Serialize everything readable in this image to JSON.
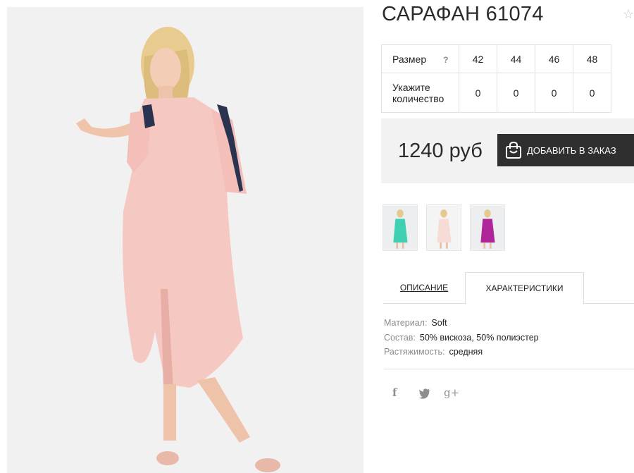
{
  "product": {
    "title": "САРАФАН 61074"
  },
  "sizes": {
    "row_label": "Размер",
    "help": "?",
    "values": [
      "42",
      "44",
      "46",
      "48"
    ],
    "qty_label_line1": "Укажите",
    "qty_label_line2": "количество",
    "quantities": [
      "0",
      "0",
      "0",
      "0"
    ]
  },
  "purchase": {
    "price": "1240 руб",
    "add_button": "ДОБАВИТЬ В ЗАКАЗ"
  },
  "thumbnails": [
    {
      "color": "#3fcfb3"
    },
    {
      "color": "#f7dcd6"
    },
    {
      "color": "#b0259a"
    }
  ],
  "tabs": {
    "description": "ОПИСАНИЕ",
    "characteristics": "ХАРАКТЕРИСТИКИ"
  },
  "characteristics": [
    {
      "key": "Материал:",
      "value": "Soft"
    },
    {
      "key": "Состав:",
      "value": "50% вискоза, 50% полиэстер"
    },
    {
      "key": "Растяжимость:",
      "value": "средняя"
    }
  ],
  "social": {
    "facebook": "f",
    "gplus": "g+"
  },
  "colors": {
    "dress": "#f6c8c2",
    "button": "#2f2f2f",
    "price_bg": "#f2f2f2"
  }
}
